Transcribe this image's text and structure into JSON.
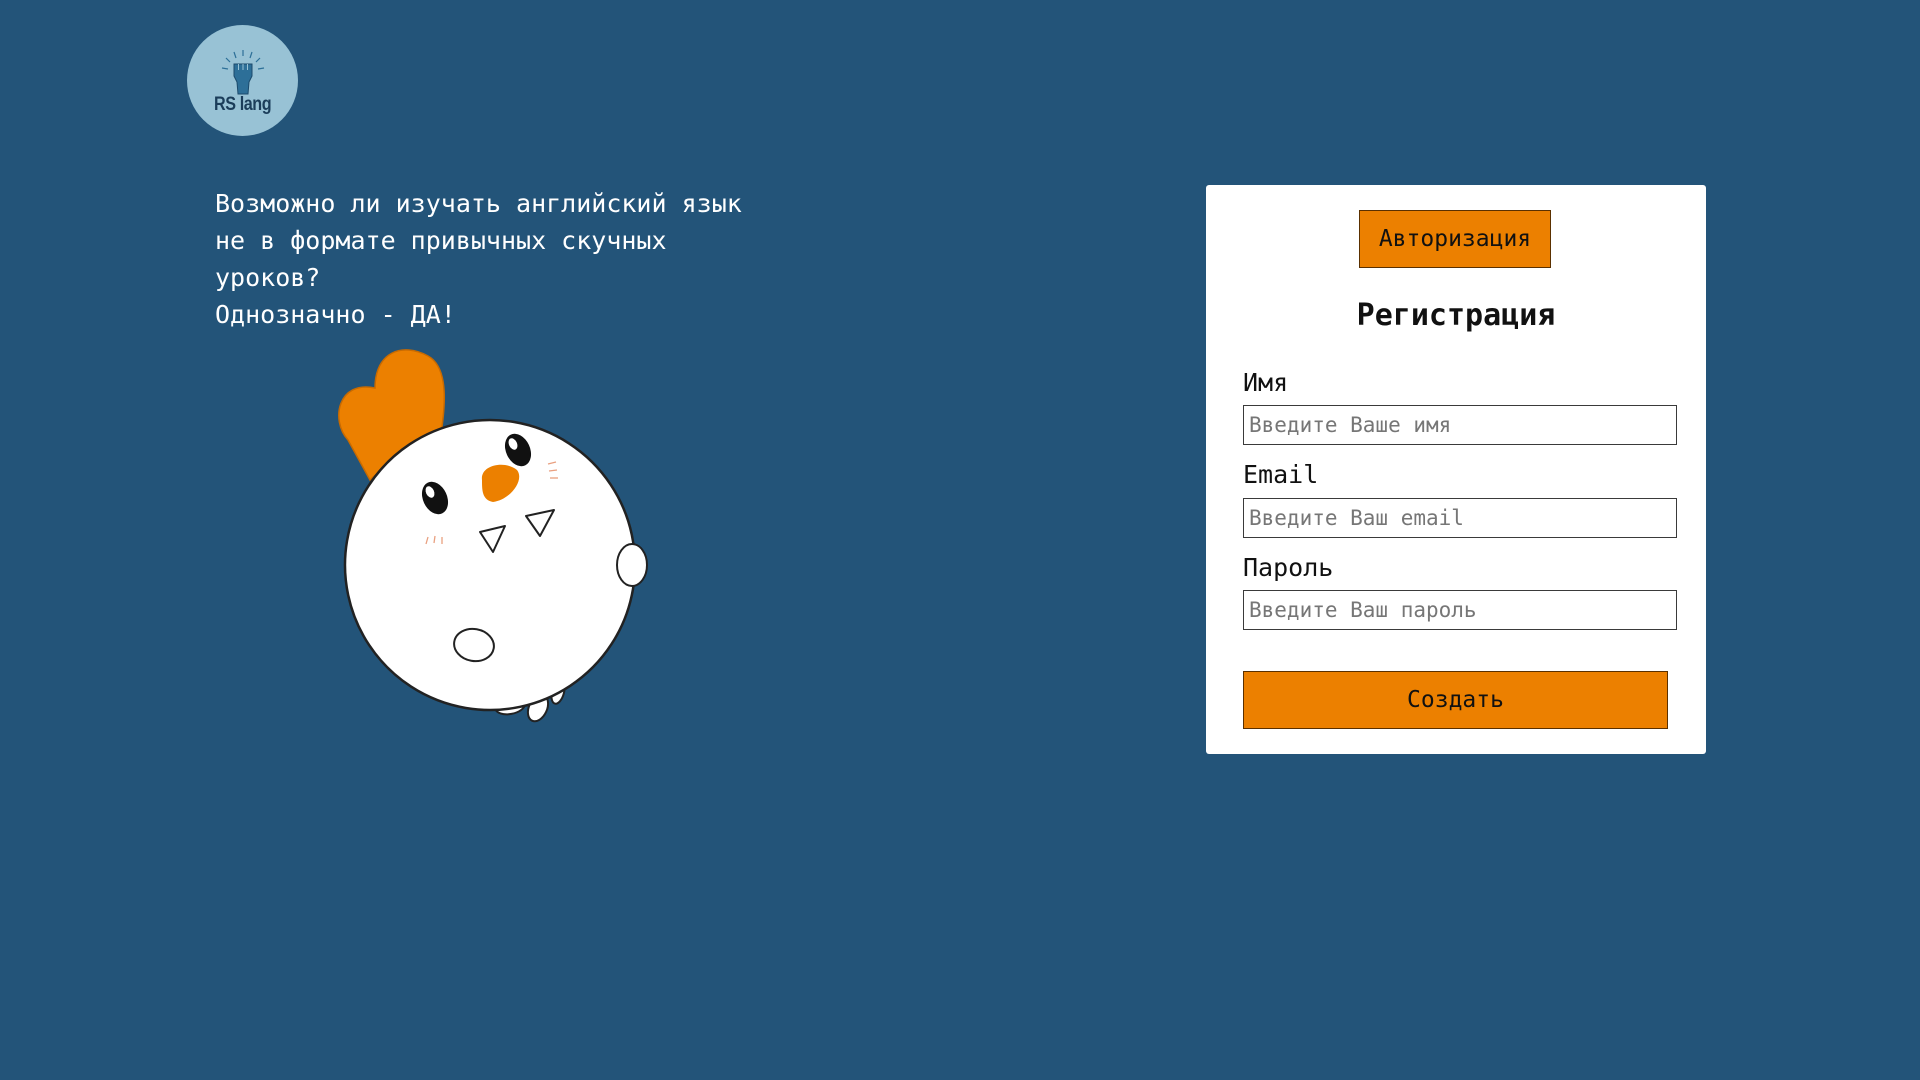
{
  "logo": {
    "text": "RS lang",
    "icon": "raised-fist-icon"
  },
  "intro": {
    "text": "Возможно ли изучать английский язык\nне в формате привычных скучных\nуроков?\nОднозначно - ДА!"
  },
  "mascot": {
    "icon": "chicken-mascot-icon"
  },
  "form": {
    "auth_tab_label": "Авторизация",
    "title": "Регистрация",
    "fields": [
      {
        "label": "Имя",
        "placeholder": "Введите Ваше имя"
      },
      {
        "label": "Email",
        "placeholder": "Введите Ваш email"
      },
      {
        "label": "Пароль",
        "placeholder": "Введите Ваш пароль"
      }
    ],
    "submit_label": "Создать"
  },
  "colors": {
    "background": "#235479",
    "accent": "#ec8000",
    "logo_circle": "#98c2d5",
    "card": "#ffffff"
  }
}
